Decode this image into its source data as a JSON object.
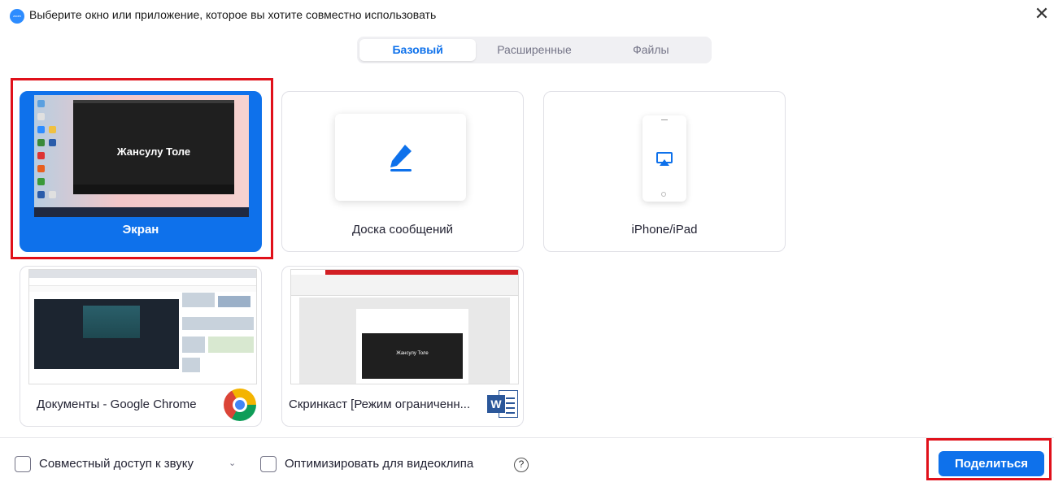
{
  "window": {
    "title": "Выберите окно или приложение, которое вы хотите совместно использовать",
    "app_icon_text": "zoom",
    "close_glyph": "✕"
  },
  "tabs": [
    {
      "label": "Базовый",
      "active": true
    },
    {
      "label": "Расширенные",
      "active": false
    },
    {
      "label": "Файлы",
      "active": false
    }
  ],
  "cards": {
    "screen": {
      "label": "Экран",
      "preview_name": "Жансулу Толе",
      "selected": true
    },
    "whiteboard": {
      "label": "Доска сообщений",
      "icon": "pencil-icon"
    },
    "iphone": {
      "label": "iPhone/iPad",
      "icon": "airplay-icon"
    },
    "chrome": {
      "label": "Документы - Google Chrome",
      "icon": "chrome-logo"
    },
    "word": {
      "label": "Скринкаст [Режим ограниченн...",
      "icon": "word-logo",
      "preview_name": "Жансулу Толе"
    }
  },
  "bottom": {
    "audio_label": "Совместный доступ к звуку",
    "audio_checked": false,
    "optimize_label": "Оптимизировать для видеоклипа",
    "optimize_checked": false,
    "help_glyph": "?",
    "share_button": "Поделиться"
  },
  "colors": {
    "accent": "#0e71eb",
    "highlight": "#e0101a"
  }
}
